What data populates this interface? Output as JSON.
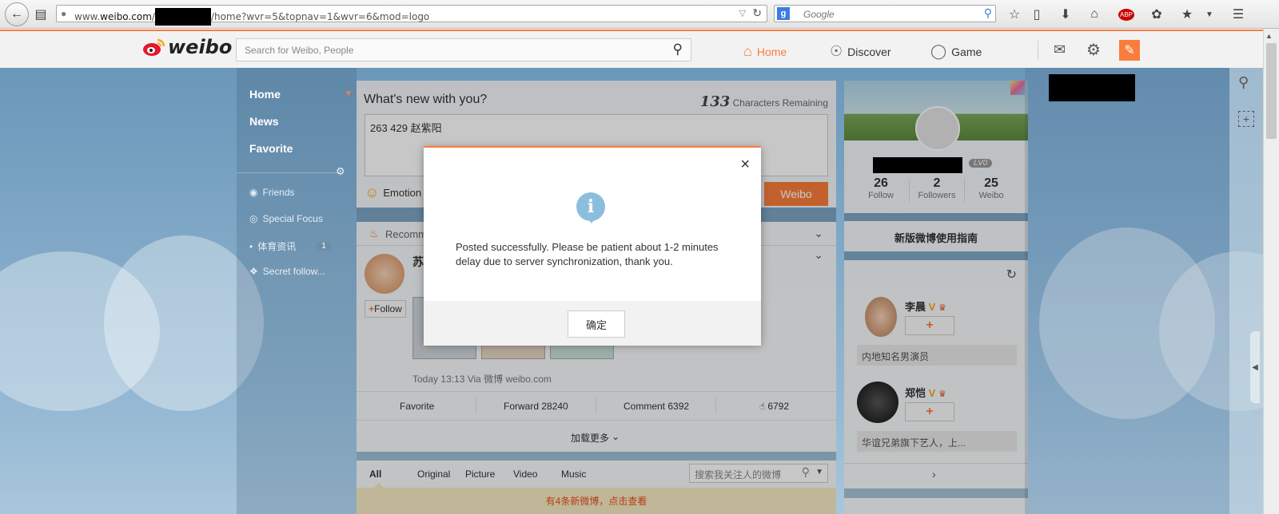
{
  "browser": {
    "url_prefix": "www.",
    "url_domain": "weibo.com",
    "url_suffix": "/home?wvr=5&topnav=1&wvr=6&mod=logo",
    "search_placeholder": "Google"
  },
  "weibo_nav": {
    "logo_text": "weibo",
    "search_placeholder": "Search for Weibo, People",
    "home_label": "Home",
    "discover_label": "Discover",
    "game_label": "Game"
  },
  "left_menu": {
    "items": [
      "Home",
      "News",
      "Favorite"
    ],
    "subs": [
      "Friends",
      "Special Focus",
      "体育资讯",
      "Secret follow..."
    ],
    "sports_badge": "1"
  },
  "composer": {
    "title": "What's new with you?",
    "chars_count": "133",
    "chars_label": "Characters Remaining",
    "text": "263  429  赵紫阳",
    "emotion_label": "Emotion",
    "post_button": "Weibo"
  },
  "feed": {
    "recommend_label": "Recomm",
    "user_initial": "苏",
    "follow_label": "Follow",
    "post_meta": "Today 13:13 Via 微博 weibo.com",
    "favorite_label": "Favorite",
    "forward_label": "Forward 28240",
    "comment_label": "Comment 6392",
    "like_count": "6792",
    "load_more": "加载更多",
    "tabs": [
      "All",
      "Original",
      "Picture",
      "Video",
      "Music"
    ],
    "search_follow_placeholder": "搜索我关注人的微博",
    "new_posts_notice": "有4条新微博，点击查看"
  },
  "profile": {
    "level": "LV0",
    "follow_count": "26",
    "follow_label": "Follow",
    "followers_count": "2",
    "followers_label": "Followers",
    "weibo_count": "25",
    "weibo_label": "Weibo",
    "guide_label": "新版微博使用指南"
  },
  "suggestions": [
    {
      "name": "李晨",
      "desc": "内地知名男演员",
      "add": "+"
    },
    {
      "name": "郑恺",
      "desc": "华谊兄弟旗下艺人，上...",
      "add": "+"
    }
  ],
  "modal": {
    "message": "Posted successfully. Please be patient about 1-2 minutes delay due to server synchronization, thank you.",
    "ok_label": "确定",
    "info_glyph": "i",
    "close_glyph": "×"
  },
  "colors": {
    "accent": "#fa7d3c",
    "info": "#8bbedc"
  }
}
